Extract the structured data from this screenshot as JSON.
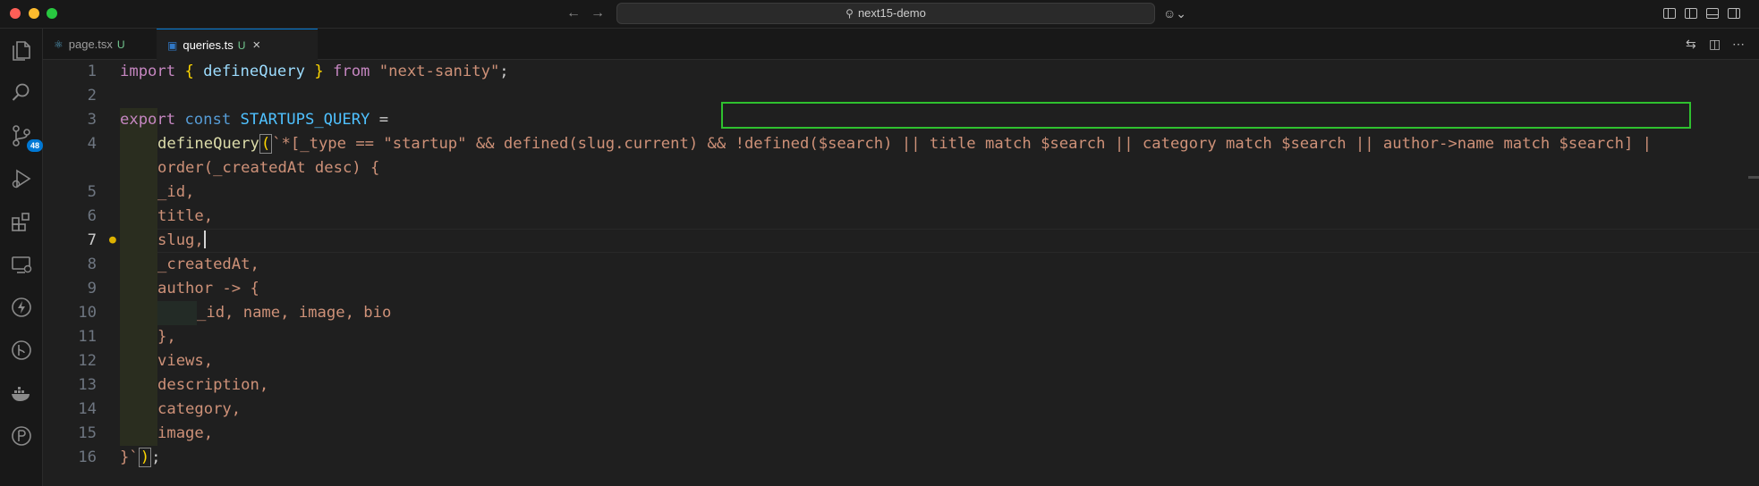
{
  "window": {
    "search_text": "next15-demo"
  },
  "tabs": [
    {
      "label": "page.tsx",
      "status": "U",
      "icon": "react-icon"
    },
    {
      "label": "queries.ts",
      "status": "U",
      "icon": "typescript-icon",
      "active": true
    }
  ],
  "activity": {
    "scm_badge": "48"
  },
  "editor": {
    "line_numbers": [
      "1",
      "2",
      "3",
      "4",
      "",
      "5",
      "6",
      "7",
      "8",
      "9",
      "10",
      "11",
      "12",
      "13",
      "14",
      "15",
      "16"
    ],
    "active_line": "7",
    "code": {
      "l1": {
        "kw": "import",
        "o": " { ",
        "fn": "defineQuery",
        "c": " } ",
        "from": "from",
        "str": " \"next-sanity\"",
        "end": ";"
      },
      "l3": {
        "kw": "export",
        "kw2": " const",
        "cst": " STARTUPS_QUERY",
        "eq": " ="
      },
      "l4": {
        "fn": "defineQuery",
        "open": "(",
        "tick": "`",
        "body": "*[_type == \"startup\" && defined(slug.current)",
        "hl": " && !defined($search) || title match $search || category match $search || author->name match $search",
        "close": "] |"
      },
      "l4b": "order(_createdAt desc) {",
      "l5": "_id,",
      "l6": "title,",
      "l7": "slug,",
      "l8": "_createdAt,",
      "l9": "author -> {",
      "l10": "_id, name, image, bio",
      "l11": "},",
      "l12": "views,",
      "l13": "description,",
      "l14": "category,",
      "l15": "image,",
      "l16": {
        "a": "}`",
        "b": ")",
        "c": ";"
      }
    }
  }
}
